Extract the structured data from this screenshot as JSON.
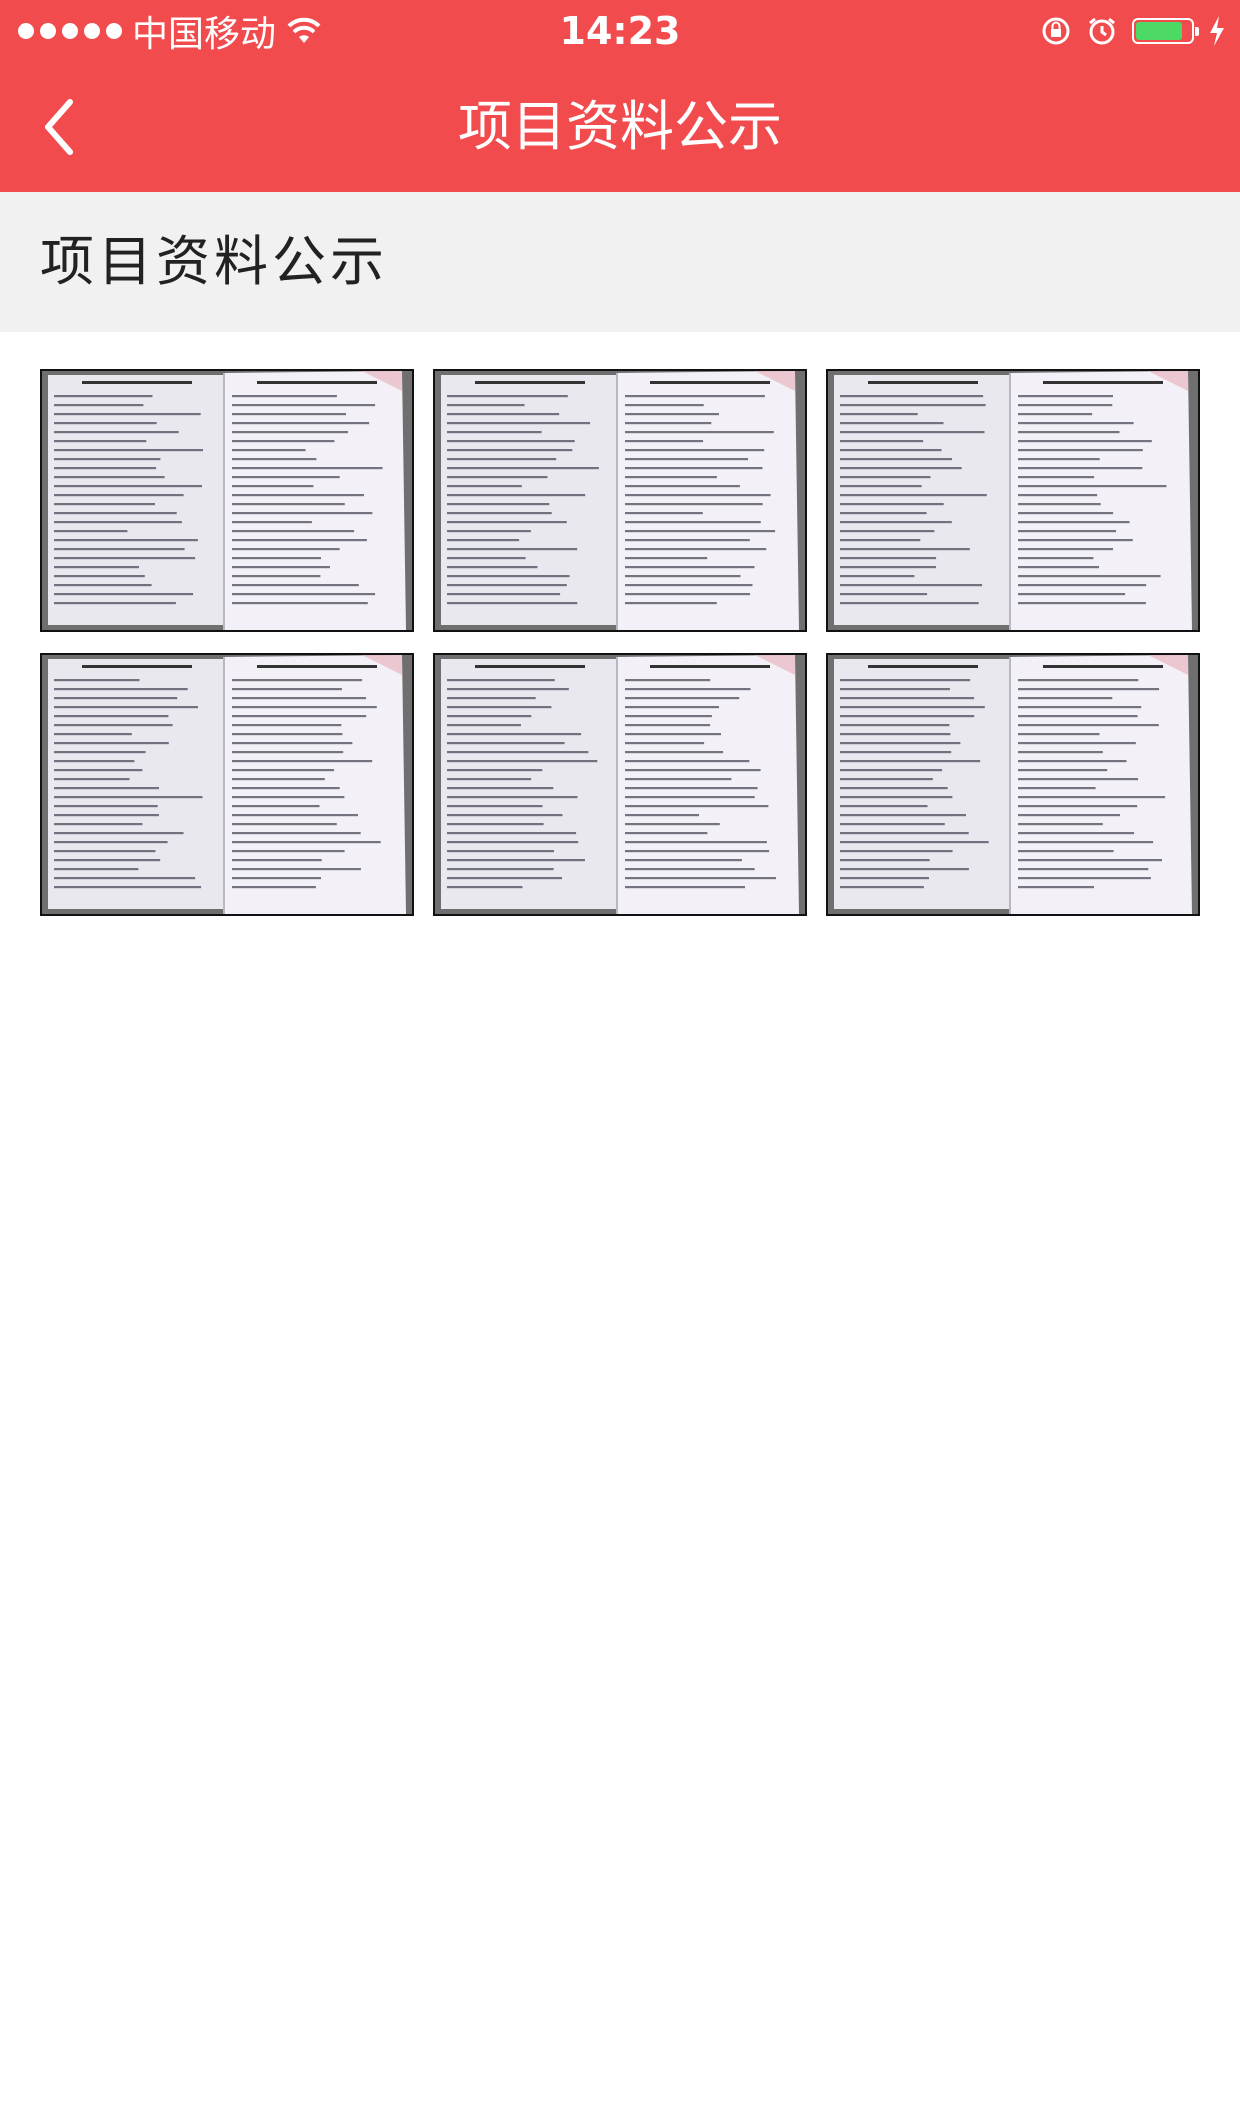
{
  "status_bar": {
    "carrier": "中国移动",
    "time": "14:23",
    "signal_dots": 5,
    "battery_level": 0.85
  },
  "nav": {
    "title": "项目资料公示",
    "back_icon": "chevron-left-icon"
  },
  "section": {
    "title": "项目资料公示"
  },
  "colors": {
    "primary": "#f24b4e",
    "header_bg": "#f1f1f1",
    "battery": "#4cd964"
  },
  "thumbnails": [
    {
      "alt": "document-photo"
    },
    {
      "alt": "document-photo"
    },
    {
      "alt": "document-photo"
    },
    {
      "alt": "document-photo"
    },
    {
      "alt": "document-photo"
    },
    {
      "alt": "document-photo"
    }
  ]
}
